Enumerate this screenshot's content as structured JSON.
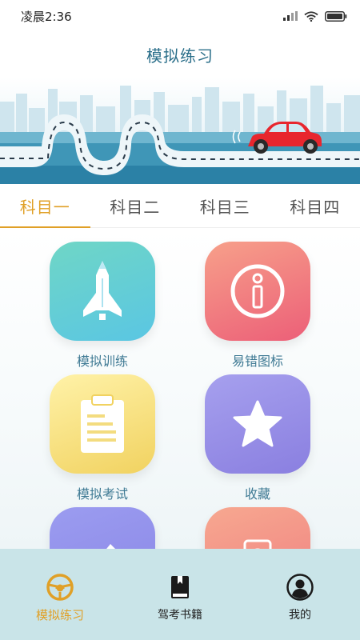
{
  "status_bar": {
    "time": "凌晨2:36",
    "icons": [
      "signal-icon",
      "wifi-icon",
      "battery-icon"
    ]
  },
  "header": {
    "title": "模拟练习"
  },
  "tabs": [
    {
      "label": "科目一",
      "active": true
    },
    {
      "label": "科目二",
      "active": false
    },
    {
      "label": "科目三",
      "active": false
    },
    {
      "label": "科目四",
      "active": false
    }
  ],
  "grid": [
    {
      "label": "模拟训练",
      "icon": "rocket-pencil-icon"
    },
    {
      "label": "易错图标",
      "icon": "info-icon"
    },
    {
      "label": "模拟考试",
      "icon": "clipboard-icon"
    },
    {
      "label": "收藏",
      "icon": "star-icon"
    },
    {
      "label": "",
      "icon": "pencil-icon"
    },
    {
      "label": "",
      "icon": "book-icon"
    }
  ],
  "bottom_nav": [
    {
      "label": "模拟练习",
      "icon": "steering-wheel-icon",
      "active": true
    },
    {
      "label": "驾考书籍",
      "icon": "book-icon",
      "active": false
    },
    {
      "label": "我的",
      "icon": "user-icon",
      "active": false
    }
  ],
  "colors": {
    "accent": "#e0a027",
    "title": "#2b6f8a",
    "bottom_nav_bg": "#c9e4e8"
  }
}
